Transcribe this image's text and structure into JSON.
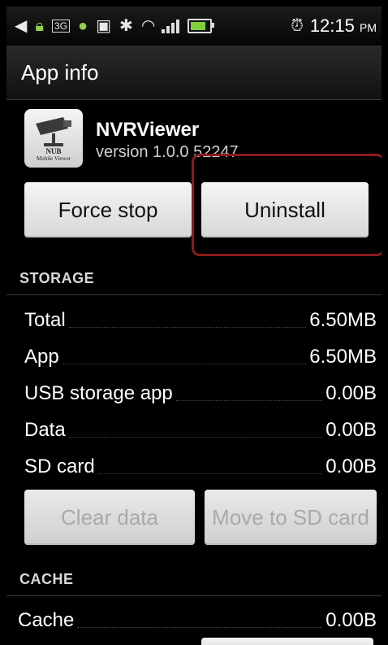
{
  "status_bar": {
    "time": "12:15",
    "ampm": "PM",
    "icons": [
      "back-icon",
      "lock-icon",
      "3g-icon",
      "android-icon",
      "image-icon",
      "bluetooth-icon",
      "wifi-icon",
      "signal-icon",
      "battery-icon",
      "alarm-icon"
    ]
  },
  "header": {
    "title": "App info"
  },
  "app": {
    "name": "NVRViewer",
    "version": "version 1.0.0 52247",
    "icon_text_line1": "NUB",
    "icon_text_line2": "Mobile Viewer"
  },
  "buttons": {
    "force_stop": "Force stop",
    "uninstall": "Uninstall",
    "clear_data": "Clear data",
    "move_to_sd": "Move to SD card"
  },
  "storage": {
    "header": "STORAGE",
    "rows": [
      {
        "label": "Total",
        "value": "6.50MB"
      },
      {
        "label": "App",
        "value": "6.50MB"
      },
      {
        "label": "USB storage app",
        "value": "0.00B"
      },
      {
        "label": "Data",
        "value": "0.00B"
      },
      {
        "label": "SD card",
        "value": "0.00B"
      }
    ]
  },
  "cache": {
    "header": "CACHE",
    "rows": [
      {
        "label": "Cache",
        "value": "0.00B"
      }
    ]
  },
  "colors": {
    "highlight": "#8b1a1a",
    "button": "#e6e6e6",
    "background": "#000000"
  }
}
